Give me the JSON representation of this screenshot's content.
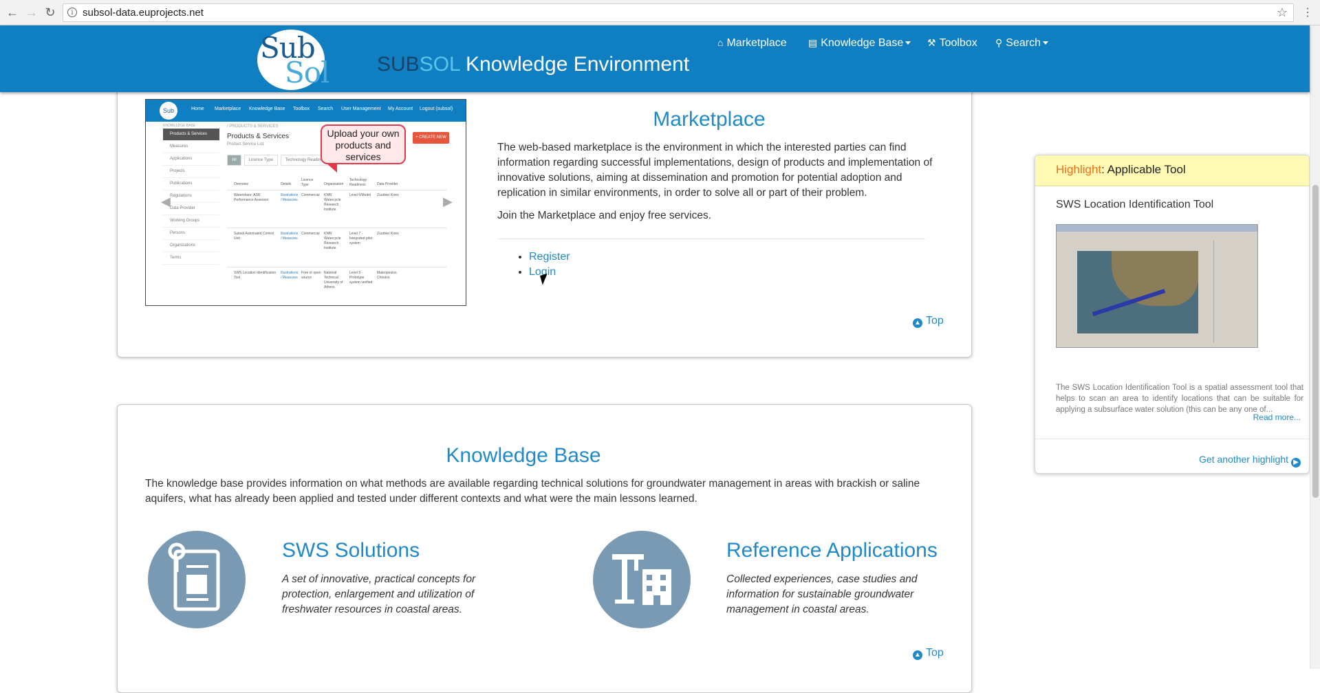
{
  "browser": {
    "url": "subsol-data.euprojects.net",
    "back_icon": "←",
    "forward_icon": "→",
    "reload_icon": "↻",
    "info_icon": "i",
    "star_icon": "☆",
    "menu_icon": "⋮"
  },
  "header": {
    "logo_top": "Sub",
    "logo_bottom": "Sol",
    "title_sub": "SUB",
    "title_sol": "SOL",
    "title_rest": " Knowledge Environment",
    "nav": [
      {
        "label": "Marketplace",
        "icon": "⌂"
      },
      {
        "label": "Knowledge Base",
        "icon": "▤"
      },
      {
        "label": "Toolbox",
        "icon": "⚒"
      },
      {
        "label": "Search",
        "icon": "⚲"
      }
    ]
  },
  "marketplace": {
    "title": "Marketplace",
    "description": "The web-based marketplace is the environment in which the interested parties can find information regarding successful implementations, design of products and implementation of innovative solutions, aiming at dissemination and promotion for potential adoption and replication in similar environments, in order to solve all or part of their problem.",
    "join_text": "Join the Marketplace and enjoy free services.",
    "links": [
      "Register",
      "Login"
    ],
    "top_label": "Top",
    "screenshot": {
      "callout": "Upload your own products and services",
      "page_title": "Products & Services",
      "page_subtitle": "Product Service List",
      "breadcrumb": "/ PRODUCTS & SERVICES",
      "create_label": "+ CREATE NEW",
      "logo": "Sub",
      "nav": [
        "Home",
        "Marketplace",
        "Knowledge Base",
        "Toolbox",
        "Search",
        "User Management",
        "My Account",
        "Logout (subsol)"
      ],
      "side_header": "KNOWLEDGE BASE",
      "side_items": [
        "Products & Services",
        "Measures",
        "Applications",
        "Projects",
        "Publications",
        "Regulations",
        "Data Provider",
        "Working Groups",
        "Persons",
        "Organizations",
        "Terms"
      ],
      "tabs": [
        "All",
        "Licence Type",
        "Technology Readiness"
      ],
      "columns": [
        "Overview",
        "Details",
        "Licence Type",
        "Organization",
        "Technology Readiness",
        "Data Provider"
      ],
      "rows": [
        {
          "overview": "Watershare: ASR Performance Assessor",
          "details": "Illustrations / Measures",
          "licence": "Commercial",
          "org": "KWR Watercycle Research Institute",
          "trl": "Level 6/Model",
          "provider": "Zuurbier Koen"
        },
        {
          "overview": "Subsol Automated Control Unit",
          "details": "Illustrations / Measures",
          "licence": "Commercial",
          "org": "KWR Watercycle Research Institute",
          "trl": "Level 7 - Integrated pilot system",
          "provider": "Zuurbier Koen"
        },
        {
          "overview": "SWS Location Identification Tool",
          "details": "Illustrations / Measures",
          "licence": "Free or open source",
          "org": "National Technical University of Athens",
          "trl": "Level 9 - Prototype system verified",
          "provider": "Makropoulos Christos"
        }
      ]
    }
  },
  "knowledge_base": {
    "title": "Knowledge Base",
    "description": "The knowledge base provides information on what methods are available regarding technical solutions for groundwater management in areas with brackish or saline aquifers, what has already been applied and tested under different contexts and what were the main lessons learned.",
    "features": [
      {
        "title": "SWS Solutions",
        "description": "A set of innovative, practical concepts for protection, enlargement and utilization of freshwater resources in coastal areas.",
        "icon": "document-icon"
      },
      {
        "title": "Reference Applications",
        "description": "Collected experiences, case studies and information for sustainable groundwater management in coastal areas.",
        "icon": "buildings-icon"
      }
    ],
    "top_label": "Top"
  },
  "highlight": {
    "label": "Highlight",
    "type": ": Applicable Tool",
    "name": "SWS Location Identification Tool",
    "description": "The SWS Location Identification Tool is a spatial assessment tool that helps to scan an area to identify locations that can be suitable for applying a subsurface water solution (this can be any one of...",
    "read_more": "Read more...",
    "another": "Get another highlight"
  },
  "colors": {
    "brand_blue": "#0f7fc1",
    "link_blue": "#1f8ac7",
    "highlight_bg": "#fff9b3",
    "circle_gray": "#7a9ab3",
    "orange": "#e8701c",
    "callout_red": "#e03a4a"
  }
}
